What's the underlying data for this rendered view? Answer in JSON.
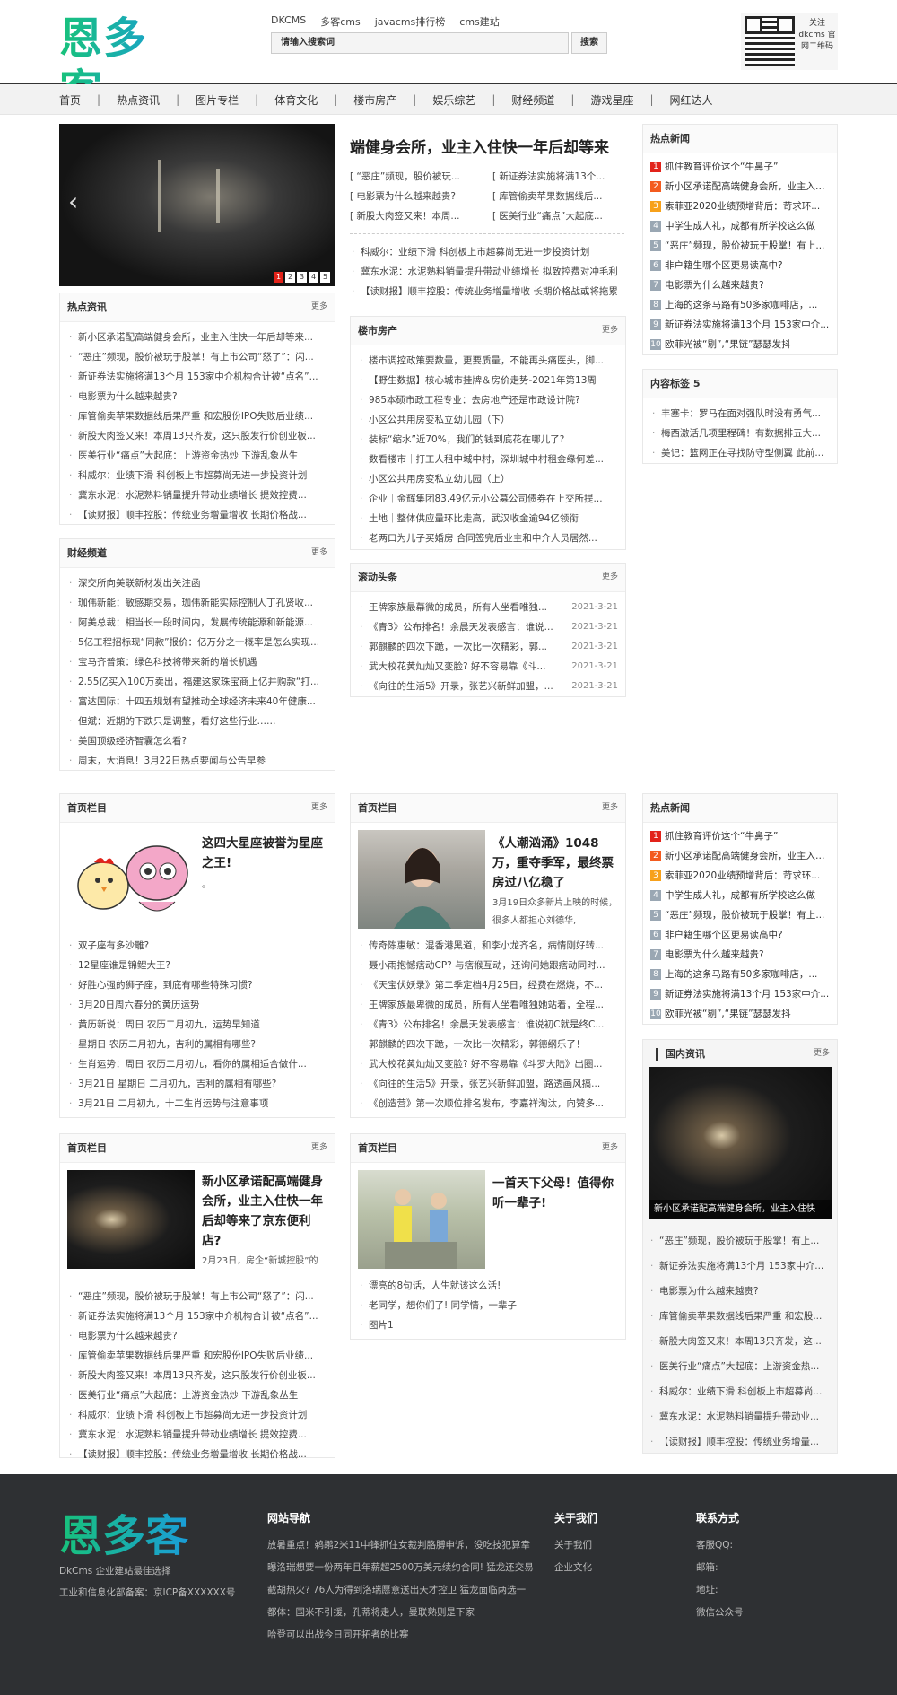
{
  "brand": {
    "logo": "恩多客",
    "accent": "#1ab98a"
  },
  "header": {
    "top_links": [
      "DKCMS",
      "多客cms",
      "javacms排行榜",
      "cms建站"
    ],
    "search_placeholder": "请输入搜索词",
    "search_button": "搜索",
    "qr_text": "关注dkcms 官网二维码"
  },
  "nav": [
    "首页",
    "热点资讯",
    "图片专栏",
    "体育文化",
    "楼市房产",
    "娱乐综艺",
    "财经频道",
    "游戏星座",
    "网红达人"
  ],
  "slider": {
    "pages": [
      "1",
      "2",
      "3",
      "4",
      "5"
    ],
    "active": 1
  },
  "headline": {
    "title": "端健身会所，业主入住快一年后却等来",
    "grid": [
      [
        "[ “恶庄”频现，股价被玩...",
        "[ 新证券法实施将满13个..."
      ],
      [
        "[ 电影票为什么越来越贵?",
        "[ 库管偷卖苹果数据线后..."
      ],
      [
        "[ 新股大肉签又来！本周...",
        "[ 医美行业“痛点”大起底..."
      ]
    ],
    "list": [
      "科威尔：业绩下滑 科创板上市超募尚无进一步投资计划",
      "冀东水泥：水泥熟料销量提升带动业绩增长 拟致控费对冲毛利",
      "【读财报】顺丰控股：传统业务增量增收 长期价格战或将拖累"
    ]
  },
  "hot_news": {
    "title": "热点新闻",
    "items": [
      "抓住教育评价这个“牛鼻子”",
      "新小区承诺配高端健身会所，业主入住...",
      "索菲亚2020业绩预增背后：苛求环...",
      "中学生成人礼，成都有所学校这么做",
      "“恶庄”频现，股价被玩于股掌！有上...",
      "非户籍生哪个区更易读高中?",
      "电影票为什么越来越贵?",
      "上海的这条马路有50多家咖啡店，...",
      "新证券法实施将满13个月 153家中介...",
      "欧菲光被“剔”,“果链”瑟瑟发抖"
    ]
  },
  "tags": {
    "title": "内容标签 5",
    "items": [
      "丰塞卡：罗马在面对强队时没有勇气...",
      "梅西激活几项里程碑！有数据排五大...",
      "美记：篮网正在寻找防守型侧翼 此前..."
    ]
  },
  "hot_info": {
    "title": "热点资讯",
    "more": "更多",
    "items": [
      "新小区承诺配高端健身会所，业主入住快一年后却等来...",
      "“恶庄”频现，股价被玩于股掌！有上市公司“怒了”：闪...",
      "新证券法实施将满13个月 153家中介机构合计被“点名”...",
      "电影票为什么越来越贵?",
      "库管偷卖苹果数据线后果严重 和宏股份IPO失败后业绩...",
      "新股大肉签又来！本周13只齐发，这只股发行价创业板...",
      "医美行业“痛点”大起底：上游资金热炒 下游乱象丛生",
      "科威尔：业绩下滑 科创板上市超募尚无进一步投资计划",
      "冀东水泥：水泥熟料销量提升带动业绩增长 提效控费...",
      "【读财报】顺丰控股：传统业务增量增收 长期价格战..."
    ]
  },
  "property": {
    "title": "楼市房产",
    "more": "更多",
    "items": [
      "楼市调控政策要数量，更要质量，不能再头痛医头，脚...",
      "【野生数据】核心城市挂牌＆房价走势-2021年第13周",
      "985本硕市政工程专业：去房地产还是市政设计院?",
      "小区公共用房变私立幼儿园（下）",
      "装标“缩水”近70%，我们的钱到底花在哪儿了?",
      "数看楼市｜打工人租中城中村，深圳城中村租金缘何差...",
      "小区公共用房变私立幼儿园（上）",
      "企业｜金辉集团83.49亿元小公募公司债券在上交所提...",
      "土地｜整体供应量环比走高，武汉收金逾94亿领衔",
      "老两口为儿子买婚房 合同签完后业主和中介人员居然..."
    ]
  },
  "finance": {
    "title": "财经频道",
    "more": "更多",
    "items": [
      "深交所向美联新材发出关注函",
      "珈伟新能：敏感期交易，珈伟新能实际控制人丁孔贤收...",
      "阿美总裁：相当长一段时间内，发展传统能源和新能源...",
      "5亿工程招标现“同款”报价：亿万分之一概率是怎么实现...",
      "宝马齐普策：绿色科技将带来新的增长机遇",
      "2.55亿买入100万卖出，福建这家珠宝商上亿并购款“打...",
      "富达国际：十四五规划有望推动全球经济未来40年健康...",
      "但斌：近期的下跌只是调整，看好这些行业……",
      "美国顶级经济智囊怎么看?",
      "周末，大消息！3月22日热点要闻与公告早参"
    ]
  },
  "scroll": {
    "title": "滚动头条",
    "more": "更多",
    "items": [
      {
        "t": "王牌家族最幕微的成员，所有人坐看唯独...",
        "d": "2021-3-21"
      },
      {
        "t": "《青3》公布排名！余晨天发表感言：谁说...",
        "d": "2021-3-21"
      },
      {
        "t": "郭麒麟的四次下跪，一次比一次精彩，郭...",
        "d": "2021-3-21"
      },
      {
        "t": "武大校花黄灿灿又变脸? 好不容易靠《斗...",
        "d": "2021-3-21"
      },
      {
        "t": "《向往的生活5》开录，张艺兴新鲜加盟，...",
        "d": "2021-3-21"
      }
    ]
  },
  "col_a": {
    "title": "首页栏目",
    "more": "更多",
    "feat_title": "这四大星座被誉为星座之王!",
    "feat_sub": "。",
    "items": [
      "双子座有多沙雕?",
      "12星座谁是锦鲤大王?",
      "好胜心强的狮子座，到底有哪些特殊习惯?",
      "3月20日周六春分的黄历运势",
      "黄历新说：周日 农历二月初九，运势早知道",
      "星期日 农历二月初九，吉利的属相有哪些?",
      "生肖运势：周日 农历二月初九，看你的属相适合做什...",
      "3月21日 星期日 二月初九，吉利的属相有哪些?",
      "3月21日 二月初九，十二生肖运势与注意事项"
    ]
  },
  "col_b": {
    "title": "首页栏目",
    "more": "更多",
    "feat_title": "《人潮汹涌》1048万，重夺季军，最终票房过八亿稳了",
    "feat_sub": "3月19日众多新片上映的时候，很多人都担心刘德华,",
    "items": [
      "传奇陈惠敏：混香港黑道，和李小龙齐名，病情刚好转...",
      "聂小雨抱憾痞动CP? 与痞猴互动，还询问她跟痞动同时...",
      "《天宝伏妖录》第二季定档4月25日，经费在燃烧，不...",
      "王牌家族最卑微的成员，所有人坐看唯独她站着，全程...",
      "《青3》公布排名！余晨天发表感言：谁说初C就是终C...",
      "郭麒麟的四次下跪，一次比一次精彩，郭德纲乐了！",
      "武大校花黄灿灿又变脸? 好不容易靠《斗罗大陆》出圈...",
      "《向往的生活5》开录，张艺兴新鲜加盟，路透画风搞...",
      "《创造营》第一次顺位排名发布，李嘉祥淘汰，向赞多..."
    ]
  },
  "hot_news2": {
    "title": "热点新闻",
    "items": [
      "抓住教育评价这个“牛鼻子”",
      "新小区承诺配高端健身会所，业主入住...",
      "索菲亚2020业绩预增背后：苛求环...",
      "中学生成人礼，成都有所学校这么做",
      "“恶庄”频现，股价被玩于股掌！有上...",
      "非户籍生哪个区更易读高中?",
      "电影票为什么越来越贵?",
      "上海的这条马路有50多家咖啡店，...",
      "新证券法实施将满13个月 153家中介...",
      "欧菲光被“剔”,“果链”瑟瑟发抖"
    ]
  },
  "domestic": {
    "title": "国内资讯",
    "more": "更多",
    "caption": "新小区承诺配高端健身会所，业主入住快",
    "items": [
      "“恶庄”频现，股价被玩于股掌！有上...",
      "新证券法实施将满13个月 153家中介...",
      "电影票为什么越来越贵?",
      "库管偷卖苹果数据线后果严重 和宏股...",
      "新股大肉签又来！本周13只齐发，这...",
      "医美行业“痛点”大起底：上游资金热...",
      "科威尔：业绩下滑 科创板上市超募尚...",
      "冀东水泥：水泥熟料销量提升带动业...",
      "【读财报】顺丰控股：传统业务增量..."
    ]
  },
  "col_c": {
    "title": "首页栏目",
    "more": "更多",
    "feat_title": "新小区承诺配高端健身会所，业主入住快一年后却等来了京东便利店?",
    "feat_sub": "2月23日，房企“新城控股”的",
    "items": [
      "“恶庄”频现，股价被玩于股掌！有上市公司“怒了”：闪...",
      "新证券法实施将满13个月 153家中介机构合计被“点名”...",
      "电影票为什么越来越贵?",
      "库管偷卖苹果数据线后果严重 和宏股份IPO失败后业绩...",
      "新股大肉签又来！本周13只齐发，这只股发行价创业板...",
      "医美行业“痛点”大起底：上游资金热炒 下游乱象丛生",
      "科威尔：业绩下滑 科创板上市超募尚无进一步投资计划",
      "冀东水泥：水泥熟料销量提升带动业绩增长 提效控费...",
      "【读财报】顺丰控股：传统业务增量增收 长期价格战..."
    ]
  },
  "col_d": {
    "title": "首页栏目",
    "more": "更多",
    "feat_title": "一首天下父母！值得你听一辈子!",
    "items": [
      "漂亮的8句话，人生就该这么活!",
      "老同学，想你们了! 同学情，一辈子",
      "图片1"
    ]
  },
  "footer": {
    "logo": "恩多客",
    "tagline": "DkCms 企业建站最佳选择",
    "icp": "工业和信息化部备案：京ICP备XXXXXX号",
    "nav_title": "网站导航",
    "nav_items": [
      "放暑重点！鹈鹕2米11中锋抓住女裁判胳膊申诉，没吃技犯算幸",
      "曝洛瑞想要一份两年且年薪超2500万美元续约合同! 猛龙还交易",
      "截胡热火? 76人为得到洛瑞愿意送出天才控卫 猛龙面临两选一",
      "都体：国米不引援，孔蒂将走人，曼联熟则是下家",
      "哈登可以出战今日同开拓者的比赛"
    ],
    "about_title": "关于我们",
    "about_items": [
      "关于我们",
      "企业文化"
    ],
    "contact_title": "联系方式",
    "contact_items": [
      "客服QQ:",
      "邮箱:",
      "地址:",
      "微信公众号"
    ]
  }
}
